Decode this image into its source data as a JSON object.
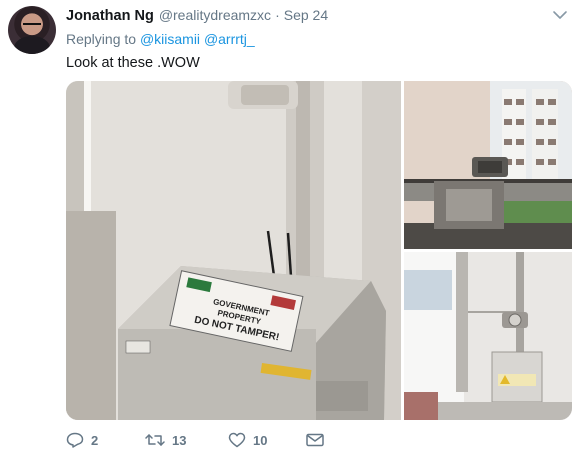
{
  "tweet": {
    "author_name": "Jonathan Ng",
    "author_handle": "@realitydreamzxc",
    "separator": "·",
    "date": "Sep 24",
    "replying_prefix": "Replying to",
    "reply_mentions": [
      "@kiisamii",
      "@arrrtj_"
    ],
    "text": "Look at these .WOW",
    "photo_texts": {
      "sign_line1": "GOVERNMENT",
      "sign_line2": "PROPERTY",
      "sign_line3": "DO NOT TAMPER!"
    }
  },
  "actions": {
    "reply_count": "2",
    "retweet_count": "13",
    "like_count": "10"
  },
  "icons": {
    "caret": "chevron-down-icon",
    "reply": "reply-icon",
    "retweet": "retweet-icon",
    "like": "heart-icon",
    "message": "envelope-icon"
  },
  "colors": {
    "link": "#1b95e0",
    "secondary_text": "#657786",
    "primary_text": "#14171a",
    "background": "#ffffff"
  }
}
